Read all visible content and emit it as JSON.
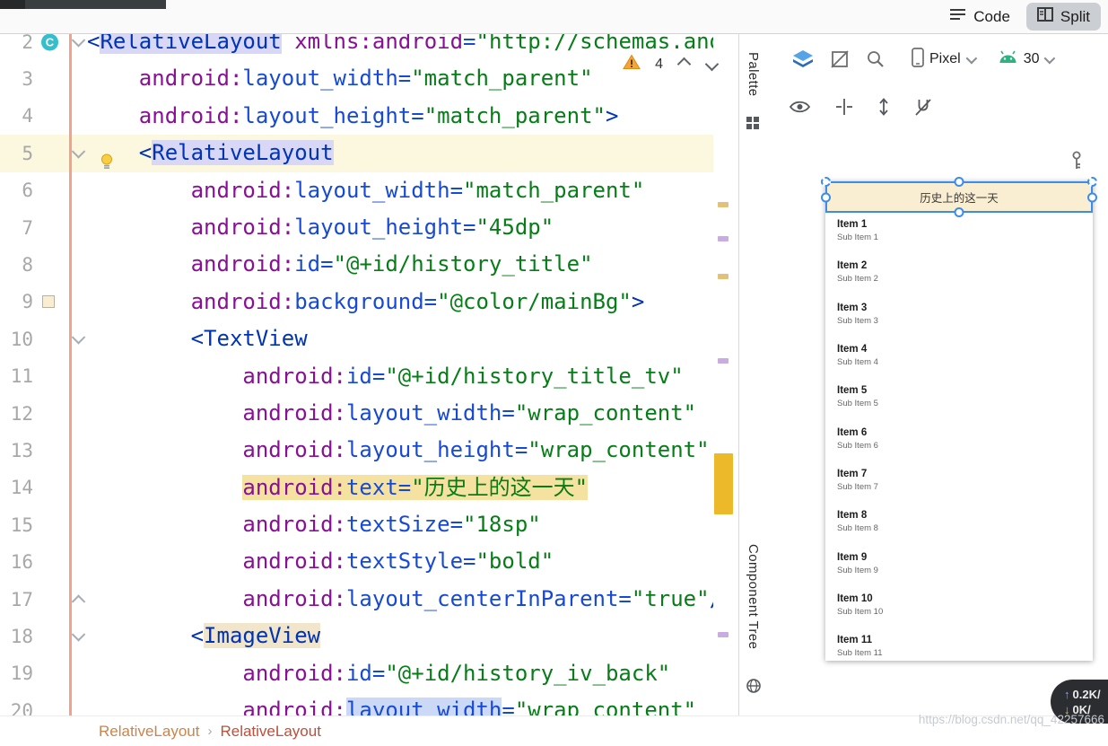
{
  "topbar": {
    "code_label": "Code",
    "split_label": "Split"
  },
  "editor": {
    "inspection_count": "4",
    "lines": [
      {
        "num": "2",
        "fold": "down",
        "badge": "C",
        "tokens": [
          {
            "t": "<",
            "c": "tag"
          },
          {
            "t": "RelativeLayout",
            "c": "tag",
            "hl": "lav"
          },
          {
            "t": " ",
            "c": "plain"
          },
          {
            "t": "xmlns:android",
            "c": "ns"
          },
          {
            "t": "=",
            "c": "attr"
          },
          {
            "t": "\"http://schemas.android.com/apk/res/android\"",
            "c": "val"
          }
        ]
      },
      {
        "num": "3",
        "tokens": [
          {
            "t": "    ",
            "c": "plain"
          },
          {
            "t": "android:",
            "c": "ns"
          },
          {
            "t": "layout_width=",
            "c": "attr"
          },
          {
            "t": "\"match_parent\"",
            "c": "val"
          }
        ]
      },
      {
        "num": "4",
        "tokens": [
          {
            "t": "    ",
            "c": "plain"
          },
          {
            "t": "android:",
            "c": "ns"
          },
          {
            "t": "layout_height=",
            "c": "attr"
          },
          {
            "t": "\"match_parent\"",
            "c": "val"
          },
          {
            "t": ">",
            "c": "tag"
          }
        ]
      },
      {
        "num": "5",
        "fold": "down",
        "bulb": true,
        "current": true,
        "tokens": [
          {
            "t": "    ",
            "c": "plain"
          },
          {
            "t": "<",
            "c": "tag"
          },
          {
            "t": "RelativeLayout",
            "c": "tag",
            "hl": "lav"
          }
        ]
      },
      {
        "num": "6",
        "tokens": [
          {
            "t": "        ",
            "c": "plain"
          },
          {
            "t": "android:",
            "c": "ns"
          },
          {
            "t": "layout_width=",
            "c": "attr"
          },
          {
            "t": "\"match_parent\"",
            "c": "val"
          }
        ]
      },
      {
        "num": "7",
        "tokens": [
          {
            "t": "        ",
            "c": "plain"
          },
          {
            "t": "android:",
            "c": "ns"
          },
          {
            "t": "layout_height=",
            "c": "attr"
          },
          {
            "t": "\"45dp\"",
            "c": "val"
          }
        ]
      },
      {
        "num": "8",
        "tokens": [
          {
            "t": "        ",
            "c": "plain"
          },
          {
            "t": "android:",
            "c": "ns"
          },
          {
            "t": "id=",
            "c": "attr"
          },
          {
            "t": "\"@+id/history_title\"",
            "c": "val"
          }
        ]
      },
      {
        "num": "9",
        "swatch": "#FAEED2",
        "tokens": [
          {
            "t": "        ",
            "c": "plain"
          },
          {
            "t": "android:",
            "c": "ns"
          },
          {
            "t": "background=",
            "c": "attr"
          },
          {
            "t": "\"@color/mainBg\"",
            "c": "val"
          },
          {
            "t": ">",
            "c": "tag"
          }
        ]
      },
      {
        "num": "10",
        "fold": "down",
        "tokens": [
          {
            "t": "        ",
            "c": "plain"
          },
          {
            "t": "<TextView",
            "c": "tag"
          }
        ]
      },
      {
        "num": "11",
        "tokens": [
          {
            "t": "            ",
            "c": "plain"
          },
          {
            "t": "android:",
            "c": "ns"
          },
          {
            "t": "id=",
            "c": "attr"
          },
          {
            "t": "\"@+id/history_title_tv\"",
            "c": "val"
          }
        ]
      },
      {
        "num": "12",
        "tokens": [
          {
            "t": "            ",
            "c": "plain"
          },
          {
            "t": "android:",
            "c": "ns"
          },
          {
            "t": "layout_width=",
            "c": "attr"
          },
          {
            "t": "\"wrap_content\"",
            "c": "val"
          }
        ]
      },
      {
        "num": "13",
        "tokens": [
          {
            "t": "            ",
            "c": "plain"
          },
          {
            "t": "android:",
            "c": "ns"
          },
          {
            "t": "layout_height=",
            "c": "attr"
          },
          {
            "t": "\"wrap_content\"",
            "c": "val"
          }
        ]
      },
      {
        "num": "14",
        "tokens": [
          {
            "t": "            ",
            "c": "plain"
          },
          {
            "t": "android:",
            "c": "ns",
            "hl": "yel"
          },
          {
            "t": "text=",
            "c": "attr",
            "hl": "yel"
          },
          {
            "t": "\"历史上的这一天\"",
            "c": "val",
            "hl": "yel"
          }
        ]
      },
      {
        "num": "15",
        "tokens": [
          {
            "t": "            ",
            "c": "plain"
          },
          {
            "t": "android:",
            "c": "ns"
          },
          {
            "t": "textSize=",
            "c": "attr"
          },
          {
            "t": "\"18sp\"",
            "c": "val"
          }
        ]
      },
      {
        "num": "16",
        "tokens": [
          {
            "t": "            ",
            "c": "plain"
          },
          {
            "t": "android:",
            "c": "ns"
          },
          {
            "t": "textStyle=",
            "c": "attr"
          },
          {
            "t": "\"bold\"",
            "c": "val"
          }
        ]
      },
      {
        "num": "17",
        "fold": "up",
        "tokens": [
          {
            "t": "            ",
            "c": "plain"
          },
          {
            "t": "android:",
            "c": "ns"
          },
          {
            "t": "layout_centerInParent=",
            "c": "attr"
          },
          {
            "t": "\"true\"",
            "c": "val"
          },
          {
            "t": "/>",
            "c": "tag"
          }
        ]
      },
      {
        "num": "18",
        "fold": "down",
        "tokens": [
          {
            "t": "        ",
            "c": "plain"
          },
          {
            "t": "<",
            "c": "tag"
          },
          {
            "t": "ImageView",
            "c": "tag",
            "hl": "tan"
          }
        ]
      },
      {
        "num": "19",
        "tokens": [
          {
            "t": "            ",
            "c": "plain"
          },
          {
            "t": "android:",
            "c": "ns"
          },
          {
            "t": "id=",
            "c": "attr"
          },
          {
            "t": "\"@+id/history_iv_back\"",
            "c": "val"
          }
        ]
      },
      {
        "num": "20",
        "tokens": [
          {
            "t": "            ",
            "c": "plain"
          },
          {
            "t": "android:",
            "c": "ns"
          },
          {
            "t": "layout_width",
            "c": "attr",
            "hl": "blue"
          },
          {
            "t": "=",
            "c": "attr"
          },
          {
            "t": "\"wrap_content\"",
            "c": "val"
          }
        ]
      }
    ]
  },
  "design": {
    "palette_label": "Palette",
    "component_tree_label": "Component Tree",
    "device_name": "Pixel",
    "api_level": "30",
    "preview": {
      "title": "历史上的这一天",
      "items": [
        {
          "title": "Item 1",
          "subtitle": "Sub Item 1"
        },
        {
          "title": "Item 2",
          "subtitle": "Sub Item 2"
        },
        {
          "title": "Item 3",
          "subtitle": "Sub Item 3"
        },
        {
          "title": "Item 4",
          "subtitle": "Sub Item 4"
        },
        {
          "title": "Item 5",
          "subtitle": "Sub Item 5"
        },
        {
          "title": "Item 6",
          "subtitle": "Sub Item 6"
        },
        {
          "title": "Item 7",
          "subtitle": "Sub Item 7"
        },
        {
          "title": "Item 8",
          "subtitle": "Sub Item 8"
        },
        {
          "title": "Item 9",
          "subtitle": "Sub Item 9"
        },
        {
          "title": "Item 10",
          "subtitle": "Sub Item 10"
        },
        {
          "title": "Item 11",
          "subtitle": "Sub Item 11"
        }
      ]
    },
    "network": {
      "up": "0.2K/",
      "down": "0K/"
    }
  },
  "breadcrumbs": {
    "items": [
      "RelativeLayout",
      "RelativeLayout"
    ],
    "separator": "›"
  },
  "watermark": "https://blog.csdn.net/qq_42257666",
  "colors": {
    "accent_blue": "#3C8DE8",
    "main_bg_swatch": "#FAEED2",
    "warning_yellow": "#F6A437",
    "find_mark_gold": "#EBB92A",
    "vcs_changed_orange": "#F1A18C"
  }
}
